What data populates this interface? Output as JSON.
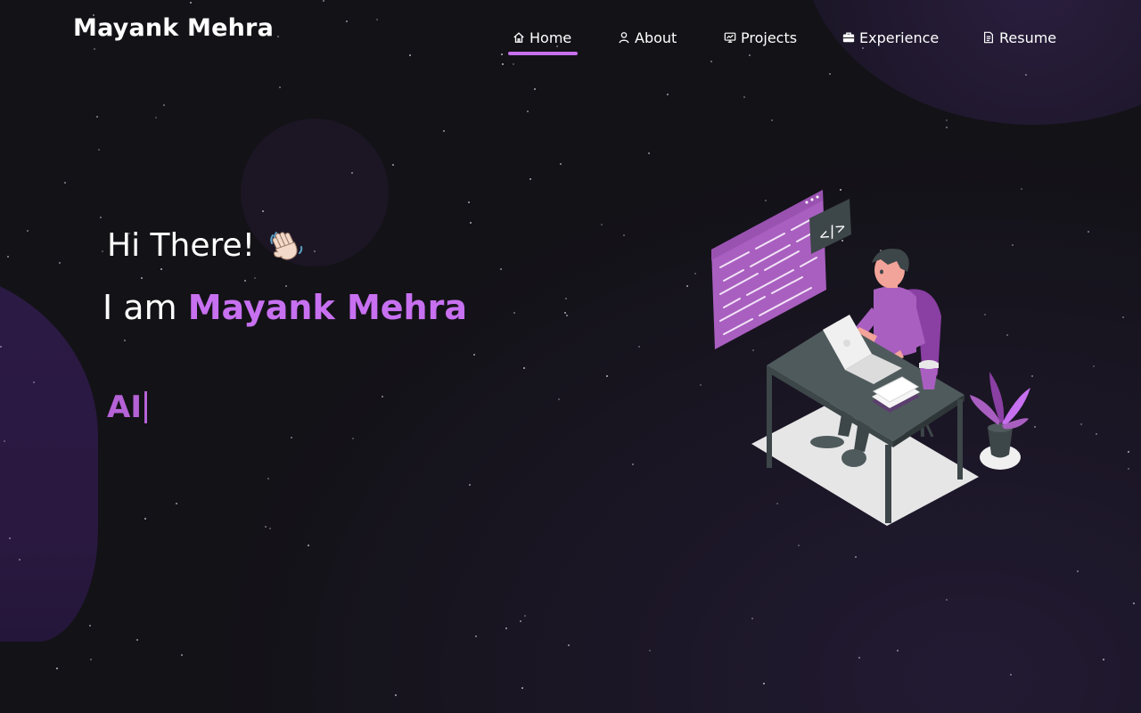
{
  "brand": {
    "name": "Mayank Mehra"
  },
  "nav": {
    "items": [
      {
        "label": "Home",
        "icon": "home-icon",
        "active": true
      },
      {
        "label": "About",
        "icon": "user-icon",
        "active": false
      },
      {
        "label": "Projects",
        "icon": "projects-icon",
        "active": false
      },
      {
        "label": "Experience",
        "icon": "briefcase-icon",
        "active": false
      },
      {
        "label": "Resume",
        "icon": "document-icon",
        "active": false
      }
    ]
  },
  "hero": {
    "greeting": "Hi There!",
    "greeting_emoji": "waving-hand-icon",
    "intro_prefix": "I am",
    "intro_name": "Mayank Mehra",
    "typewriter_text": "AI"
  },
  "colors": {
    "accent": "#c770f0",
    "background": "#131217",
    "blob": "#2b1a44"
  }
}
